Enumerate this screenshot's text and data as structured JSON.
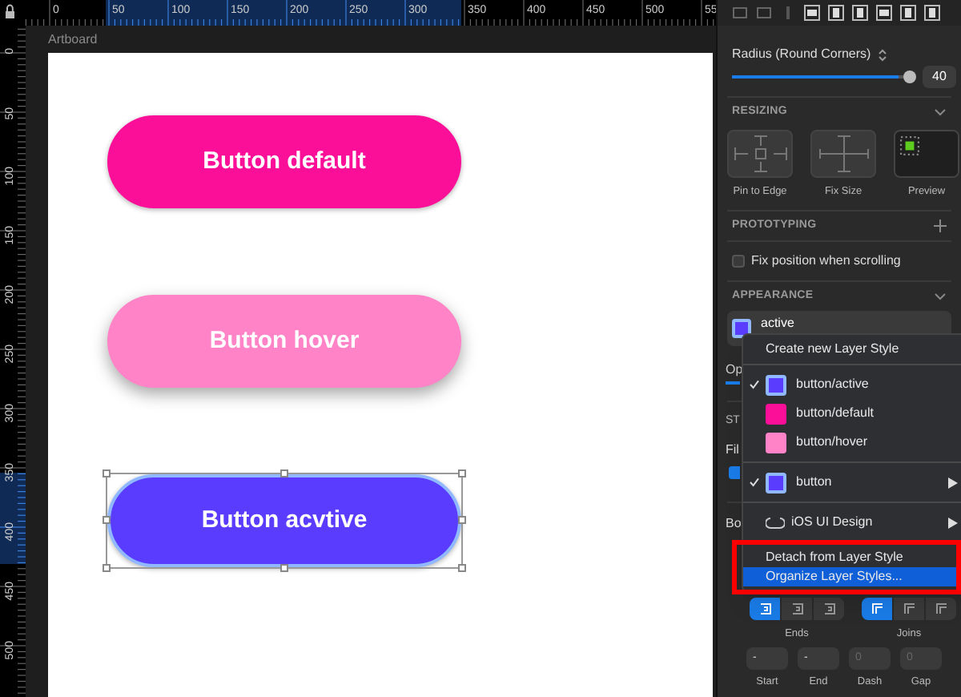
{
  "top_ruler": {
    "labels": [
      "0",
      "50",
      "100",
      "150",
      "200",
      "250",
      "300",
      "350",
      "400",
      "450",
      "500",
      "55"
    ]
  },
  "left_ruler": {
    "labels": [
      "0",
      "50",
      "100",
      "150",
      "200",
      "250",
      "300",
      "350",
      "400",
      "450",
      "500"
    ]
  },
  "canvas": {
    "artboard_label": "Artboard",
    "buttons": [
      {
        "label": "Button default",
        "color": "#fb0f98",
        "selected": false,
        "shadow": false
      },
      {
        "label": "Button hover",
        "color": "#ff83c6",
        "selected": false,
        "shadow": true
      },
      {
        "label": "Button acvtive",
        "color": "#5a3cff",
        "selected": true,
        "shadow": false
      }
    ]
  },
  "inspector": {
    "radius": {
      "label": "Radius (Round Corners)",
      "level": 0.97,
      "value": "40"
    },
    "resizing": {
      "title": "RESIZING",
      "options": [
        {
          "label": "Pin to Edge",
          "kind": "pin"
        },
        {
          "label": "Fix Size",
          "kind": "fix"
        },
        {
          "label": "Preview",
          "kind": "preview"
        }
      ]
    },
    "prototyping": {
      "title": "PROTOTYPING",
      "fix_position": {
        "label": "Fix position when scrolling",
        "checked": false
      }
    },
    "appearance": {
      "title": "APPEARANCE",
      "style_name": "active"
    },
    "hidden_labels": [
      "Op",
      "ST",
      "Fil",
      "Bo"
    ],
    "fill_checkbox": {
      "checked": true
    },
    "ends": {
      "label": "Ends",
      "options": [
        {
          "selected": true
        },
        {
          "selected": false
        },
        {
          "selected": false
        }
      ]
    },
    "joins": {
      "label": "Joins",
      "options": [
        {
          "selected": true
        },
        {
          "selected": false
        },
        {
          "selected": false
        }
      ]
    },
    "fields": [
      {
        "label": "Start",
        "value": "-",
        "kind": "stepper"
      },
      {
        "label": "End",
        "value": "-",
        "kind": "stepper"
      },
      {
        "label": "Dash",
        "placeholder": "0",
        "kind": "plain"
      },
      {
        "label": "Gap",
        "placeholder": "0",
        "kind": "plain"
      }
    ]
  },
  "style_menu": {
    "items": [
      {
        "kind": "action",
        "label": "Create new Layer Style"
      },
      {
        "kind": "separator"
      },
      {
        "kind": "style",
        "label": "button/active",
        "color": "#5a3cff",
        "checked": true
      },
      {
        "kind": "style",
        "label": "button/default",
        "color": "#fb0f98",
        "checked": false
      },
      {
        "kind": "style",
        "label": "button/hover",
        "color": "#ff83c6",
        "checked": false
      },
      {
        "kind": "separator"
      },
      {
        "kind": "group",
        "label": "button",
        "color": "#5a3cff",
        "checked": true
      },
      {
        "kind": "separator"
      },
      {
        "kind": "library",
        "label": "iOS UI Design"
      },
      {
        "kind": "separator"
      },
      {
        "kind": "action",
        "label": "Detach from Layer Style",
        "selected": false
      },
      {
        "kind": "action",
        "label": "Organize Layer Styles...",
        "selected": true
      }
    ]
  }
}
